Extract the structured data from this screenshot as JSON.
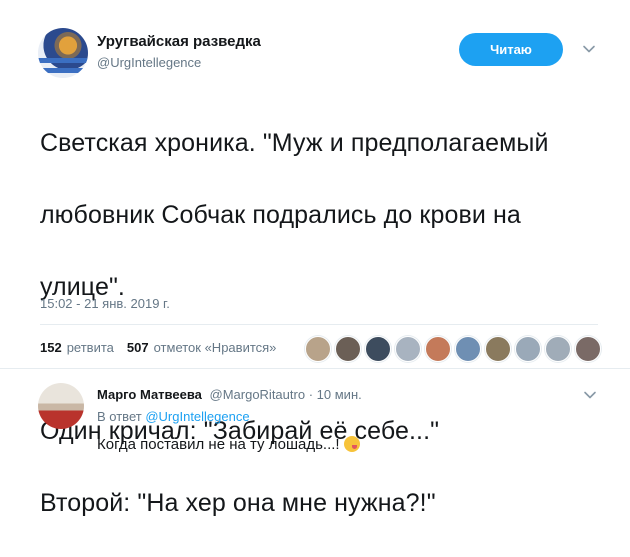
{
  "tweet": {
    "author_name": "Уругвайская разведка",
    "author_handle": "@UrgIntellegence",
    "follow_label": "Читаю",
    "text_lines": [
      "Светская хроника. \"Муж и предполагаемый",
      "любовник Собчак подрались до крови на",
      "улице\".",
      "",
      "Один кричал: \"Забирай её себе...\"",
      "Второй: \"На хер она мне нужна?!\""
    ],
    "timestamp": "15:02 - 21 янв. 2019 г.",
    "retweets_count": "152",
    "retweets_label": "ретвита",
    "likes_count": "507",
    "likes_label": "отметок «Нравится»",
    "likers": [
      {
        "color": "#b8a38a"
      },
      {
        "color": "#6b5f56"
      },
      {
        "color": "#3d4c5e"
      },
      {
        "color": "#a8b3c0"
      },
      {
        "color": "#c47a5a"
      },
      {
        "color": "#6f8fb3"
      },
      {
        "color": "#8a7a5e"
      },
      {
        "color": "#9aa9b8"
      },
      {
        "color": "#a0acb8"
      },
      {
        "color": "#7a6a66"
      }
    ]
  },
  "reply": {
    "author_name": "Марго Матвеева",
    "author_handle": "@MargoRitautro",
    "separator": "·",
    "time": "10 мин.",
    "in_reply_prefix": "В ответ",
    "in_reply_mention": "@UrgIntellegence",
    "text": "Когда поставил не на ту лошадь...!",
    "emoji": "face-savoring-food-emoji"
  },
  "colors": {
    "accent": "#1da1f2",
    "secondary_text": "#657786",
    "divider": "#e6ecf0"
  }
}
